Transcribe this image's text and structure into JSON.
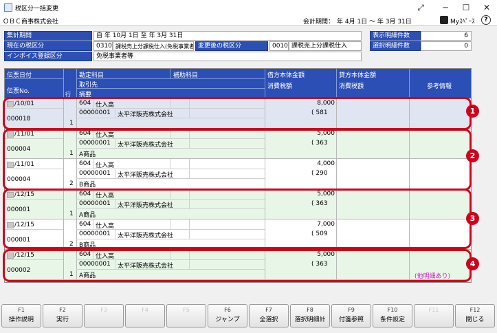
{
  "window": {
    "title": "税区分一括変更"
  },
  "company": {
    "name": "ＯＢＣ商事株式会社",
    "period_label": "会計期間：",
    "period_value": "年 4月 1日 ～ 年 3月 31日",
    "my_space": "Myｽﾍﾟｰｽ"
  },
  "header": {
    "period_label": "集計期間",
    "period_value": "自 年 10月 1日 至 年 3月 31日",
    "current_tax_label": "現在の税区分",
    "current_tax_code": "0310",
    "current_tax_name": "課税売上分課税仕入(免税事業者等)",
    "new_tax_label": "変更後の税区分",
    "new_tax_code": "0010",
    "new_tax_name": "課税売上分課税仕入",
    "invoice_label": "インボイス登録区分",
    "invoice_value": "免税事業者等",
    "display_count_label": "表示明細件数",
    "display_count_value": "6",
    "selected_count_label": "選択明細件数",
    "selected_count_value": "0"
  },
  "columns": {
    "date": "伝票日付",
    "slip_no": "伝票No.",
    "line": "行",
    "account": "勘定科目",
    "sub_account": "補助科目",
    "partner": "取引先",
    "summary": "摘要",
    "debit": "借方本体金額",
    "debit_tax": "消費税額",
    "credit": "貸方本体金額",
    "credit_tax": "消費税額",
    "reference": "参考情報"
  },
  "rows": [
    {
      "date": "/10/01",
      "slip": "000018",
      "line": "1",
      "code": "604",
      "account": "仕入高",
      "partner_code": "00000001",
      "partner": "太平洋販売株式会社",
      "summary": "",
      "debit": "8,000",
      "tax": "( 581",
      "ref": ""
    },
    {
      "date": "/11/01",
      "slip": "000004",
      "line": "1",
      "code": "604",
      "account": "仕入高",
      "partner_code": "00000001",
      "partner": "太平洋販売株式会社",
      "summary": "A商品",
      "debit": "5,000",
      "tax": "( 363",
      "ref": ""
    },
    {
      "date": "/11/01",
      "slip": "000004",
      "line": "2",
      "code": "604",
      "account": "仕入高",
      "partner_code": "00000001",
      "partner": "太平洋販売株式会社",
      "summary": "B商品",
      "debit": "4,000",
      "tax": "( 290",
      "ref": ""
    },
    {
      "date": "/12/15",
      "slip": "000001",
      "line": "1",
      "code": "604",
      "account": "仕入高",
      "partner_code": "00000001",
      "partner": "太平洋販売株式会社",
      "summary": "A商品",
      "debit": "5,000",
      "tax": "( 363",
      "ref": ""
    },
    {
      "date": "/12/15",
      "slip": "000001",
      "line": "2",
      "code": "604",
      "account": "仕入高",
      "partner_code": "00000001",
      "partner": "太平洋販売株式会社",
      "summary": "B商品",
      "debit": "7,000",
      "tax": "( 509",
      "ref": ""
    },
    {
      "date": "/12/15",
      "slip": "000002",
      "line": "1",
      "code": "604",
      "account": "仕入高",
      "partner_code": "00000001",
      "partner": "太平洋販売株式会社",
      "summary": "A商品",
      "debit": "5,000",
      "tax": "( 363",
      "ref": "(他明細あり)"
    }
  ],
  "markers": [
    "1",
    "2",
    "3",
    "4"
  ],
  "fkeys": [
    {
      "key": "F1",
      "label": "操作説明",
      "enabled": true
    },
    {
      "key": "F2",
      "label": "実行",
      "enabled": true
    },
    {
      "key": "F3",
      "label": "",
      "enabled": false
    },
    {
      "key": "F4",
      "label": "",
      "enabled": false
    },
    {
      "key": "F5",
      "label": "",
      "enabled": false
    },
    {
      "key": "F6",
      "label": "ジャンプ",
      "enabled": true
    },
    {
      "key": "F7",
      "label": "全選択",
      "enabled": true
    },
    {
      "key": "F8",
      "label": "選択明細計",
      "enabled": true
    },
    {
      "key": "F9",
      "label": "付箋参照",
      "enabled": true
    },
    {
      "key": "F10",
      "label": "条件設定",
      "enabled": true
    },
    {
      "key": "F11",
      "label": "",
      "enabled": false
    },
    {
      "key": "F12",
      "label": "閉じる",
      "enabled": true
    }
  ],
  "colors": {
    "header_blue": "#2c4fb6",
    "highlight_red": "#d0021b",
    "reference_pink": "#d020c0"
  }
}
